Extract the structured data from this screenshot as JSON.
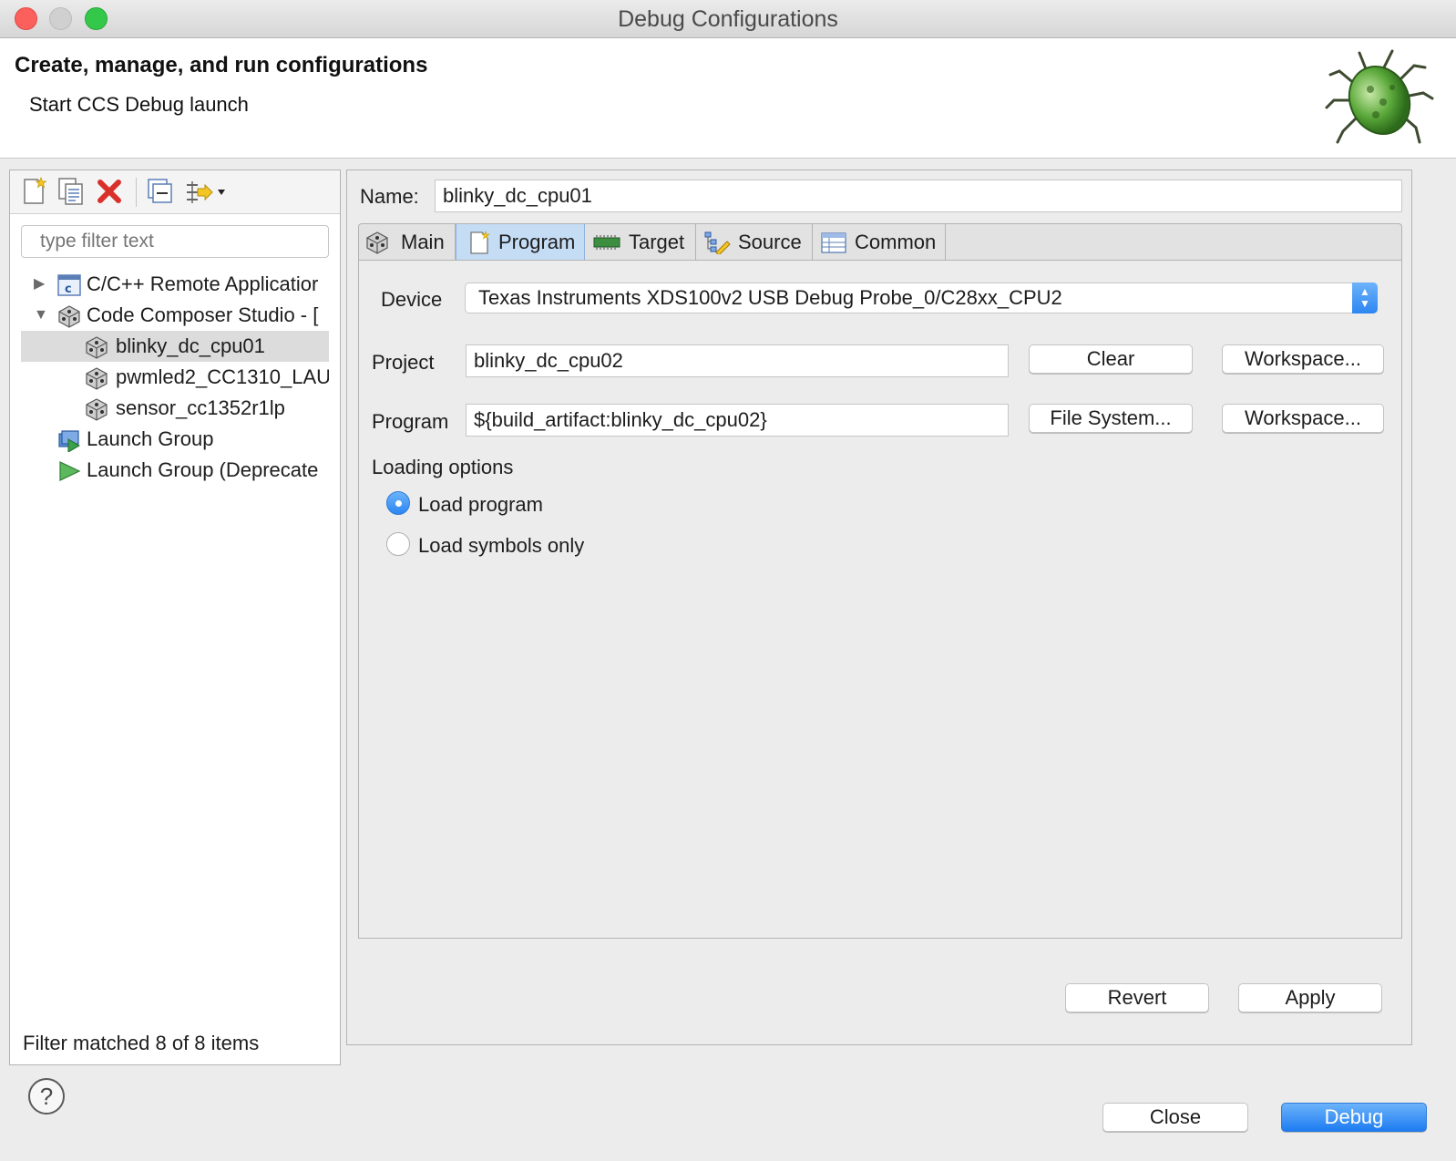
{
  "window": {
    "title": "Debug Configurations"
  },
  "header": {
    "title": "Create, manage, and run configurations",
    "subtitle": "Start CCS Debug launch"
  },
  "left": {
    "filter_placeholder": "type filter text",
    "tree": [
      {
        "label": "C/C++ Remote Applicatior",
        "icon": "c-config-icon",
        "expanded": false
      },
      {
        "label": "Code Composer Studio - [",
        "icon": "ccs-cube-icon",
        "expanded": true
      },
      {
        "label": "blinky_dc_cpu01",
        "icon": "ccs-cube-icon",
        "selected": true
      },
      {
        "label": "pwmled2_CC1310_LAU",
        "icon": "ccs-cube-icon"
      },
      {
        "label": "sensor_cc1352r1lp",
        "icon": "ccs-cube-icon"
      },
      {
        "label": "Launch Group",
        "icon": "launch-group-icon"
      },
      {
        "label": "Launch Group (Deprecate",
        "icon": "launch-arrow-icon"
      }
    ],
    "status": "Filter matched 8 of 8 items"
  },
  "config": {
    "name_label": "Name:",
    "name_value": "blinky_dc_cpu01",
    "tabs": [
      {
        "label": "Main",
        "icon": "cube-icon"
      },
      {
        "label": "Program",
        "icon": "program-file-icon",
        "active": true
      },
      {
        "label": "Target",
        "icon": "chip-icon"
      },
      {
        "label": "Source",
        "icon": "source-tree-icon"
      },
      {
        "label": "Common",
        "icon": "table-icon"
      }
    ],
    "device_label": "Device",
    "device_value": "Texas Instruments XDS100v2 USB Debug Probe_0/C28xx_CPU2",
    "project_label": "Project",
    "project_value": "blinky_dc_cpu02",
    "clear_label": "Clear",
    "workspace_label": "Workspace...",
    "program_label": "Program",
    "program_value": "${build_artifact:blinky_dc_cpu02}",
    "filesystem_label": "File System...",
    "workspace2_label": "Workspace...",
    "loading_label": "Loading options",
    "opt_load_program": "Load program",
    "opt_load_symbols": "Load symbols only",
    "selected_option": "Load program",
    "revert_label": "Revert",
    "apply_label": "Apply"
  },
  "footer": {
    "help_label": "?",
    "close_label": "Close",
    "debug_label": "Debug"
  },
  "colors": {
    "accent": "#2d86f2",
    "tab_active": "#c5dcf5",
    "selection": "#dcdcdc"
  }
}
